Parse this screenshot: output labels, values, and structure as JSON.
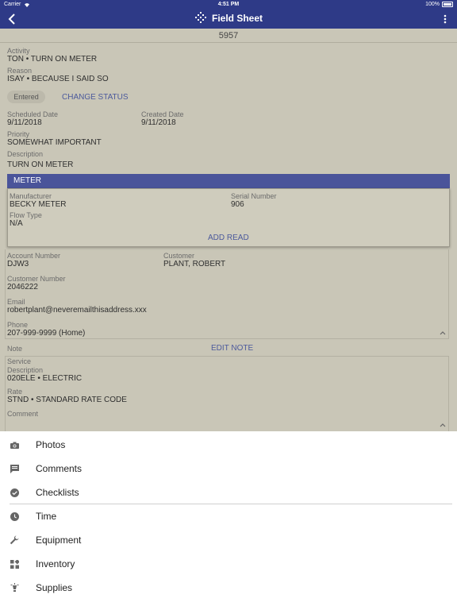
{
  "status_bar": {
    "carrier": "Carrier",
    "time": "4:51 PM",
    "battery": "100%"
  },
  "nav": {
    "title": "Field Sheet"
  },
  "record_number": "5957",
  "activity": {
    "label": "Activity",
    "value": "TON • TURN ON METER"
  },
  "reason": {
    "label": "Reason",
    "value": "ISAY • BECAUSE I SAID SO"
  },
  "status": {
    "chip": "Entered",
    "change_link": "CHANGE STATUS"
  },
  "scheduled_date": {
    "label": "Scheduled Date",
    "value": "9/11/2018"
  },
  "created_date": {
    "label": "Created Date",
    "value": "9/11/2018"
  },
  "priority": {
    "label": "Priority",
    "value": "SOMEWHAT IMPORTANT"
  },
  "description": {
    "label": "Description",
    "value": "TURN ON METER"
  },
  "meter": {
    "header": "METER",
    "manufacturer": {
      "label": "Manufacturer",
      "value": "BECKY METER"
    },
    "serial_number": {
      "label": "Serial Number",
      "value": "906"
    },
    "flow_type": {
      "label": "Flow Type",
      "value": "N/A"
    },
    "add_read": "ADD READ"
  },
  "account_number": {
    "label": "Account Number",
    "value": "DJW3"
  },
  "customer": {
    "label": "Customer",
    "value": "PLANT, ROBERT"
  },
  "customer_number": {
    "label": "Customer Number",
    "value": "2046222"
  },
  "email": {
    "label": "Email",
    "value": "robertplant@neveremailthisaddress.xxx"
  },
  "phone": {
    "label": "Phone",
    "value": "207-999-9999 (Home)"
  },
  "note": {
    "label": "Note",
    "edit_link": "EDIT NOTE"
  },
  "service": {
    "label": "Service",
    "description": {
      "label": "Description",
      "value": "020ELE • ELECTRIC"
    },
    "rate": {
      "label": "Rate",
      "value": "STND • STANDARD RATE CODE"
    },
    "comment": {
      "label": "Comment"
    }
  },
  "menu": {
    "photos": "Photos",
    "comments": "Comments",
    "checklists": "Checklists",
    "time": "Time",
    "equipment": "Equipment",
    "inventory": "Inventory",
    "supplies": "Supplies"
  },
  "colors": {
    "nav_bar": "#2e3a87",
    "link": "#4c5a9c",
    "overlay": "#c9c6b7"
  }
}
